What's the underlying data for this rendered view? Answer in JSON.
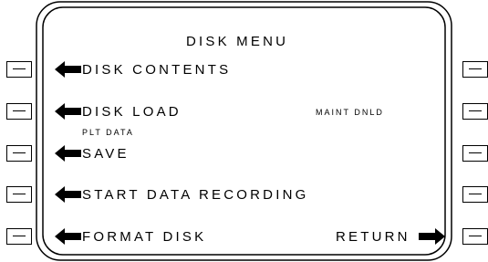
{
  "title": "DISK MENU",
  "left_options": [
    {
      "label": "DISK CONTENTS"
    },
    {
      "label": "DISK LOAD"
    },
    {
      "label": "SAVE",
      "caption": "PLT DATA"
    },
    {
      "label": "START DATA RECORDING"
    },
    {
      "label": "FORMAT DISK"
    }
  ],
  "right_options": [
    {
      "label": "MAINT DNLD"
    },
    {
      "label": "RETURN"
    }
  ]
}
